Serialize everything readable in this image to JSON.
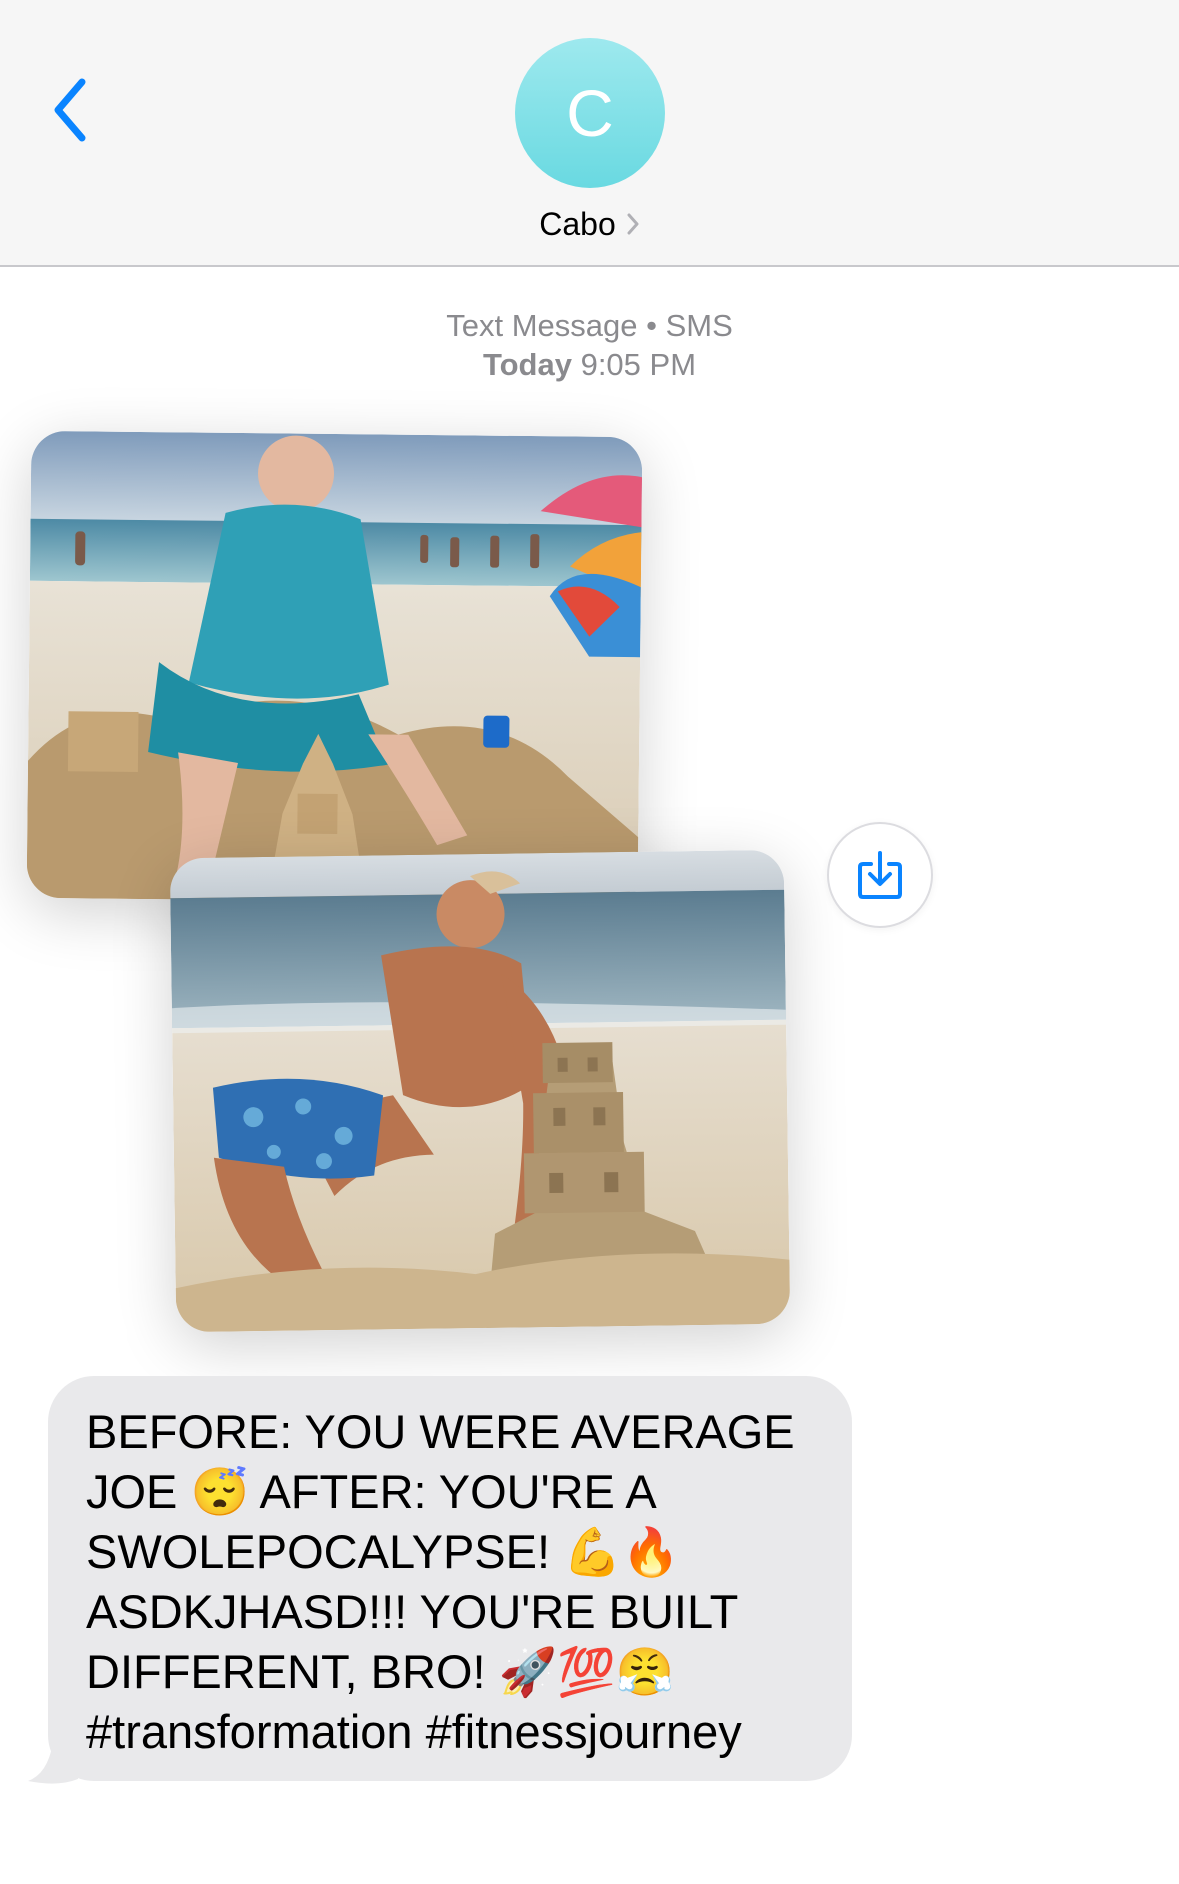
{
  "header": {
    "back_icon": "chevron-left-icon",
    "avatar_initial": "C",
    "contact_name": "Cabo",
    "contact_chevron_icon": "chevron-right-icon"
  },
  "thread": {
    "service_label": "Text Message • SMS",
    "day_label": "Today",
    "time_label": "9:05 PM"
  },
  "attachments": [
    {
      "kind": "photo",
      "subject": "before"
    },
    {
      "kind": "photo",
      "subject": "after"
    }
  ],
  "actions": {
    "save_icon": "save-to-photos-icon"
  },
  "message": {
    "text": "BEFORE: YOU WERE AVERAGE JOE 😴 AFTER: YOU'RE A SWOLEPOCALYPSE! 💪🔥 ASDKJHASD!!! YOU'RE BUILT DIFFERENT, BRO! 🚀💯😤 #transformation #fitnessjourney"
  },
  "colors": {
    "accent": "#0a84ff",
    "header_bg": "#f6f6f6",
    "bubble_bg": "#e9e9eb",
    "avatar": "#7ee0e7",
    "meta_text": "#8a8a8e"
  }
}
